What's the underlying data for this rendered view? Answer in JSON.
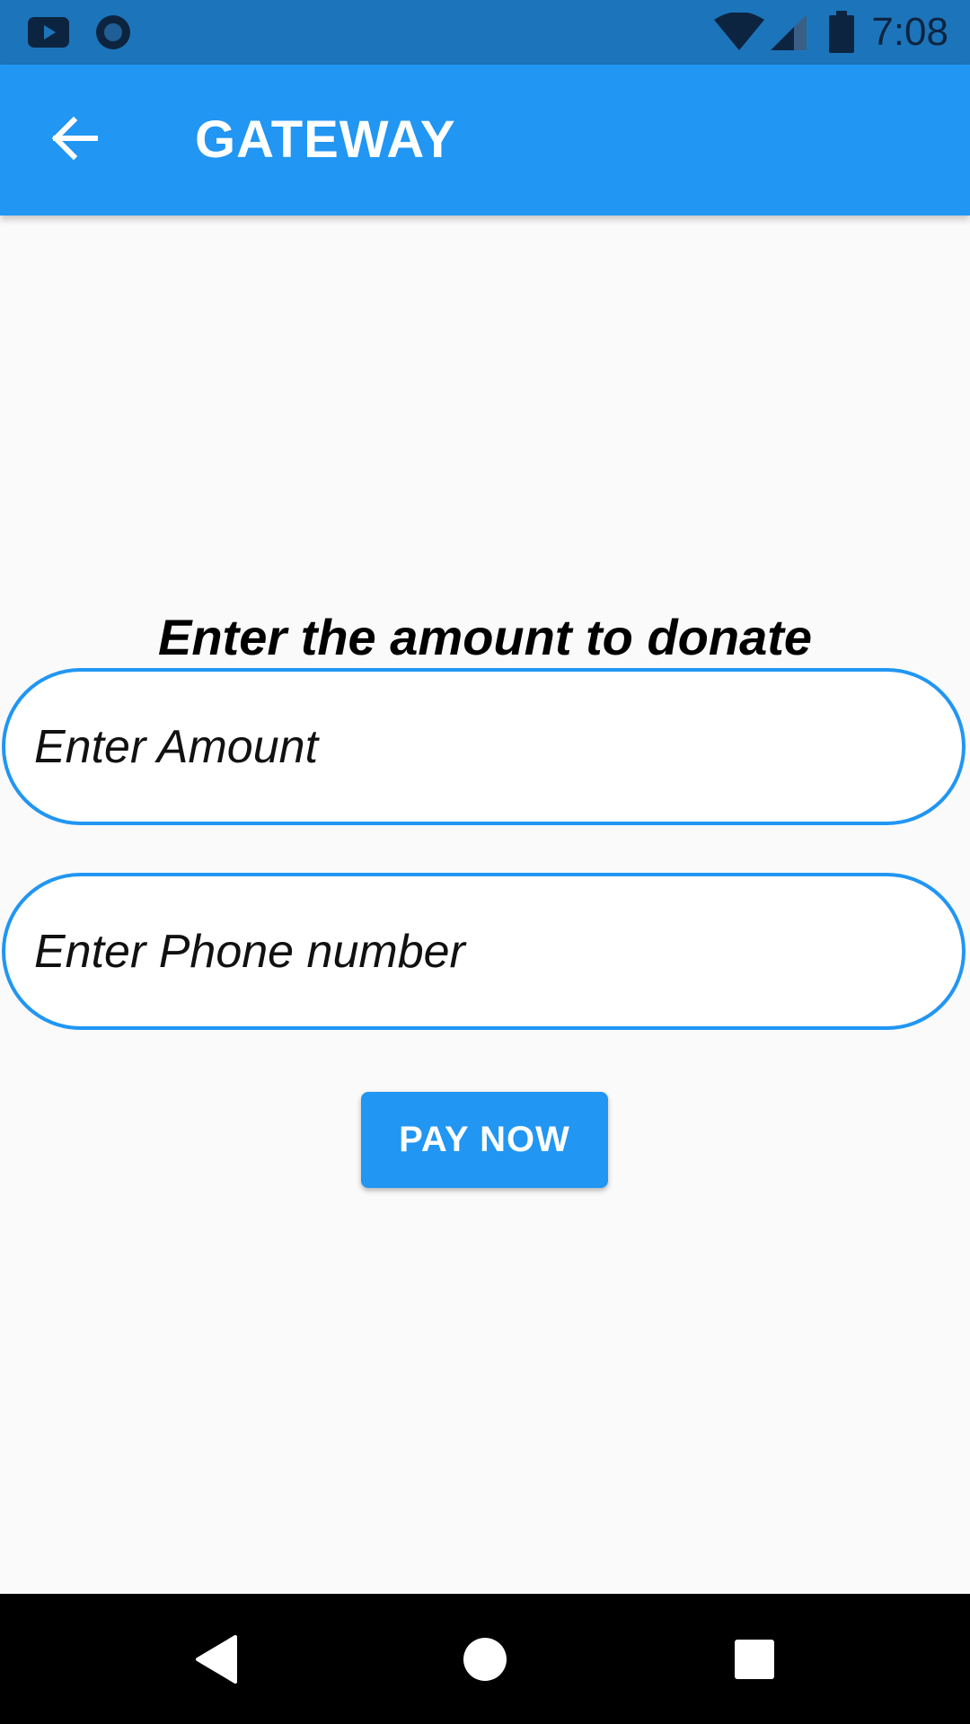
{
  "status_bar": {
    "time": "7:08",
    "left_icons": [
      "youtube-icon",
      "circle-notification-icon"
    ],
    "right_icons": [
      "wifi-icon",
      "cell-signal-icon",
      "battery-icon"
    ]
  },
  "app_bar": {
    "title": "GATEWAY",
    "back_icon": "arrow-back-icon",
    "color": "#2196f3"
  },
  "form": {
    "heading": "Enter the amount to donate",
    "amount": {
      "placeholder": "Enter Amount",
      "value": ""
    },
    "phone": {
      "placeholder": "Enter Phone number",
      "value": ""
    },
    "pay_button_label": "PAY NOW"
  },
  "nav_bar": {
    "buttons": [
      "back-triangle-icon",
      "home-circle-icon",
      "recents-square-icon"
    ]
  }
}
